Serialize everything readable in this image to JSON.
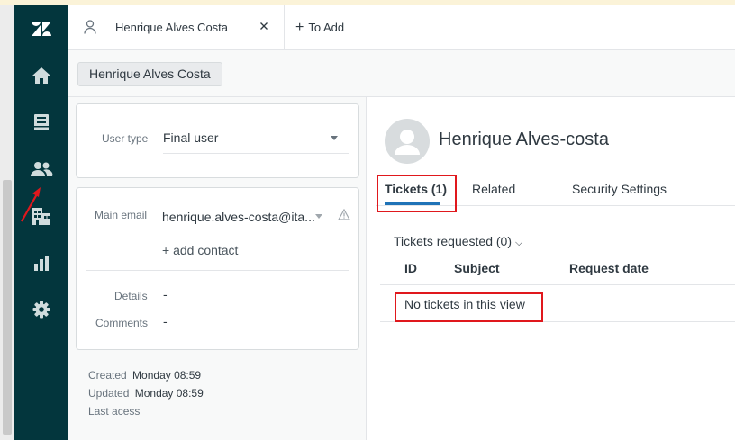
{
  "tab": {
    "title": "Henrique Alves Costa",
    "add_label": "To Add"
  },
  "breadcrumb": "Henrique Alves Costa",
  "user_fields": {
    "user_type_label": "User type",
    "user_type_value": "Final user",
    "main_email_label": "Main email",
    "main_email_value": "henrique.alves-costa@ita...",
    "add_contact": "+ add contact",
    "details_label": "Details",
    "details_value": "-",
    "comments_label": "Comments",
    "comments_value": "-"
  },
  "meta": {
    "created_label": "Created",
    "created_value": "Monday 08:59",
    "updated_label": "Updated",
    "updated_value": "Monday 08:59",
    "last_access_label": "Last acess"
  },
  "profile": {
    "name": "Henrique Alves-costa"
  },
  "profile_tabs": [
    "Tickets (1)",
    "Related",
    "Security Settings"
  ],
  "tickets": {
    "requested_label": "Tickets requested (0)",
    "columns": [
      "ID",
      "Subject",
      "Request date"
    ],
    "empty_message": "No tickets in this view"
  },
  "colors": {
    "nav_bg": "#03363d",
    "accent": "#1f73b7",
    "highlight": "#e0181d"
  }
}
